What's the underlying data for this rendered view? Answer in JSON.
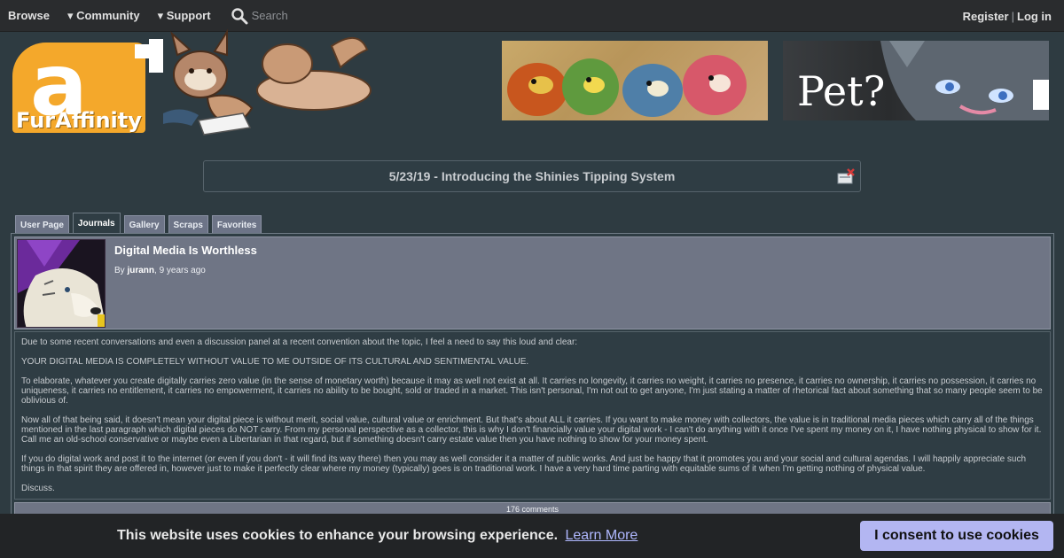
{
  "nav": {
    "browse": "Browse",
    "community": "▾ Community",
    "support": "▾ Support",
    "search_placeholder": "Search",
    "register": "Register",
    "separator": "|",
    "login": "Log in"
  },
  "logo": {
    "text": "FurAffinity",
    "letter": "a"
  },
  "banner2_text": "Pet?",
  "notice": "5/23/19 - Introducing the Shinies Tipping System",
  "tabs": [
    "User Page",
    "Journals",
    "Gallery",
    "Scraps",
    "Favorites"
  ],
  "active_tab": "Journals",
  "journal": {
    "title": "Digital Media Is Worthless",
    "by": "By",
    "author": "jurann",
    "age": ", 9 years ago",
    "paragraphs": [
      "Due to some recent conversations and even a discussion panel at a recent convention about the topic, I feel a need to say this loud and clear:",
      "YOUR DIGITAL MEDIA IS COMPLETELY WITHOUT VALUE TO ME OUTSIDE OF ITS CULTURAL AND SENTIMENTAL VALUE.",
      "To elaborate, whatever you create digitally carries zero value (in the sense of monetary worth) because it may as well not exist at all. It carries no longevity, it carries no weight, it carries no presence, it carries no ownership, it carries no possession, it carries no uniqueness, it carries no entitlement, it carries no empowerment, it carries no ability to be bought, sold or traded in a market. This isn't personal, I'm not out to get anyone, I'm just stating a matter of rhetorical fact about something that so many people seem to be oblivious of.",
      "Now all of that being said, it doesn't mean your digital piece is without merit, social value, cultural value or enrichment. But that's about ALL it carries. If you want to make money with collectors, the value is in traditional media pieces which carry all of the things mentioned in the last paragraph which digital pieces do NOT carry. From my personal perspective as a collector, this is why I don't financially value your digital work - I can't do anything with it once I've spent my money on it, I have nothing physical to show for it. Call me an old-school conservative or maybe even a Libertarian in that regard, but if something doesn't carry estate value then you have nothing to show for your money spent.",
      "If you do digital work and post it to the internet (or even if you don't - it will find its way there) then you may as well consider it a matter of public works. And just be happy that it promotes you and your social and cultural agendas. I will happily appreciate such things in that spirit they are offered in, however just to make it perfectly clear where my money (typically) goes is on traditional work. I have a very hard time parting with equitable sums of it when I'm getting nothing of physical value.",
      "Discuss."
    ],
    "comments": "176 comments"
  },
  "cookie": {
    "message": "This website uses cookies to enhance your browsing experience.",
    "learn_more": "Learn More",
    "consent": "I consent to use cookies"
  },
  "colors": {
    "background": "#2e3b41",
    "header_panel": "#6f7585",
    "logo_orange": "#f4a82b",
    "consent_button": "#b3b6f2"
  }
}
